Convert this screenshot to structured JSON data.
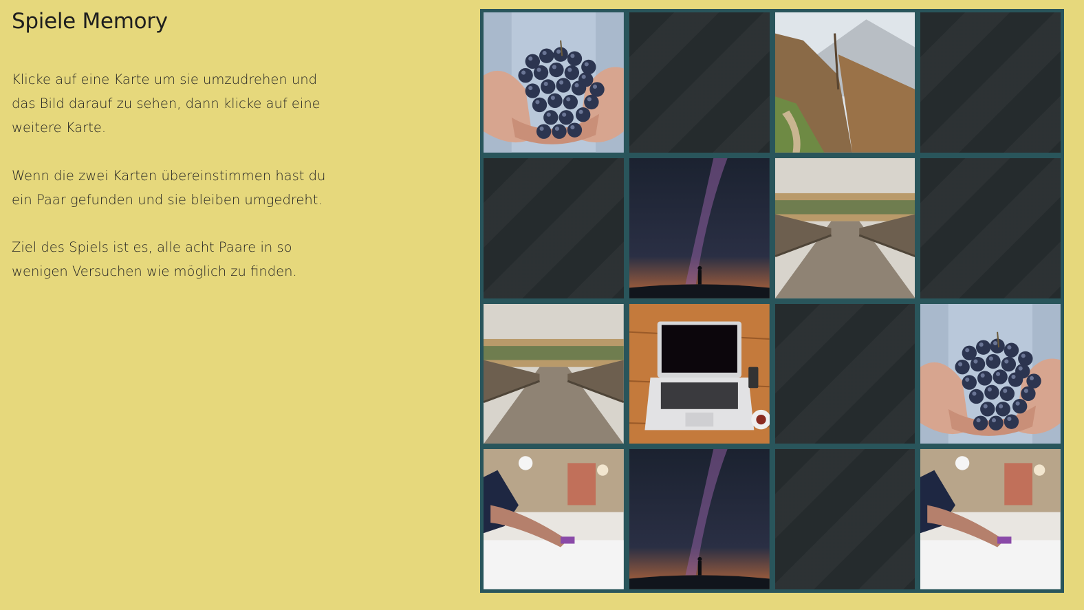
{
  "title": "Spiele Memory",
  "instructions": [
    "Klicke auf eine Karte um sie umzudrehen und das Bild darauf zu sehen, dann klicke auf eine weitere Karte.",
    "Wenn die zwei Karten übereinstimmen hast du ein Paar gefunden und sie bleiben umgedreht.",
    "Ziel des Spiels ist es, alle acht Paare in so wenigen Versuchen wie möglich zu finden."
  ],
  "colors": {
    "background": "#e6d87c",
    "board_frame": "#29555b",
    "card_back": "#252b2d"
  },
  "cards": [
    {
      "state": "face-up",
      "image": "grapes"
    },
    {
      "state": "face-down",
      "image": ""
    },
    {
      "state": "face-up",
      "image": "mountain-forest"
    },
    {
      "state": "face-down",
      "image": ""
    },
    {
      "state": "face-down",
      "image": ""
    },
    {
      "state": "face-up",
      "image": "milky-way"
    },
    {
      "state": "face-up",
      "image": "wooden-bridge"
    },
    {
      "state": "face-down",
      "image": ""
    },
    {
      "state": "face-up",
      "image": "wooden-bridge"
    },
    {
      "state": "face-up",
      "image": "laptop"
    },
    {
      "state": "face-down",
      "image": ""
    },
    {
      "state": "face-up",
      "image": "grapes"
    },
    {
      "state": "face-up",
      "image": "mixing-console"
    },
    {
      "state": "face-up",
      "image": "milky-way"
    },
    {
      "state": "face-down",
      "image": ""
    },
    {
      "state": "face-up",
      "image": "mixing-console"
    }
  ]
}
